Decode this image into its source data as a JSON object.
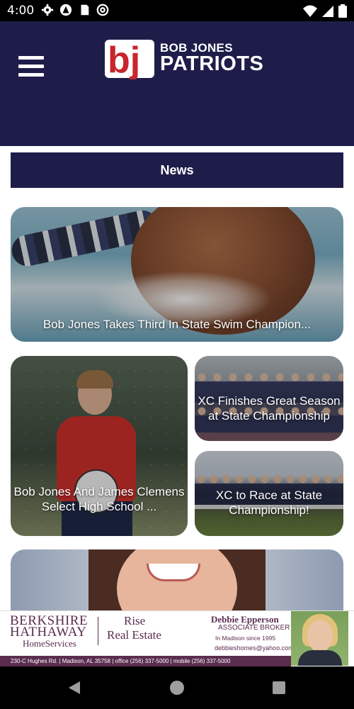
{
  "status_bar": {
    "time": "4:00",
    "left_icons": [
      "gear-icon",
      "alert-icon",
      "sd-card-icon",
      "at-sign-icon"
    ],
    "right_icons": [
      "wifi-icon",
      "cell-signal-icon",
      "battery-icon"
    ]
  },
  "header": {
    "logo_mark": "bj",
    "logo_line1": "BOB JONES",
    "logo_line2": "PATRIOTS",
    "menu_icon": "hamburger-menu-icon",
    "background": "#1e1d4a"
  },
  "news": {
    "title": "News",
    "cards": [
      {
        "caption": "Bob Jones Takes Third In State Swim Champion..."
      },
      {
        "caption": "Bob Jones And James Clemens Select High School ..."
      },
      {
        "caption": "XC Finishes Great Season at State Championship"
      },
      {
        "caption": "XC to Race at State Championship!"
      }
    ]
  },
  "ad": {
    "brand_line1": "BERKSHIRE",
    "brand_line2": "HATHAWAY",
    "brand_line3": "HomeServices",
    "agency_line1": "Rise",
    "agency_line2": "Real Estate",
    "agent_name": "Debbie Epperson",
    "agent_role": "ASSOCIATE BROKER",
    "agent_since": "In Madison since 1995",
    "agent_email": "debbieshomes@yahoo.com",
    "footer": "230-C Hughes Rd.  |  Madison, AL 35758  |  office (256) 337-5000  |  mobile (256) 337-5000",
    "accent": "#5a2d4f"
  },
  "nav_bar": {
    "back_icon": "back-triangle-icon",
    "home_icon": "home-circle-icon",
    "recents_icon": "recents-square-icon"
  }
}
